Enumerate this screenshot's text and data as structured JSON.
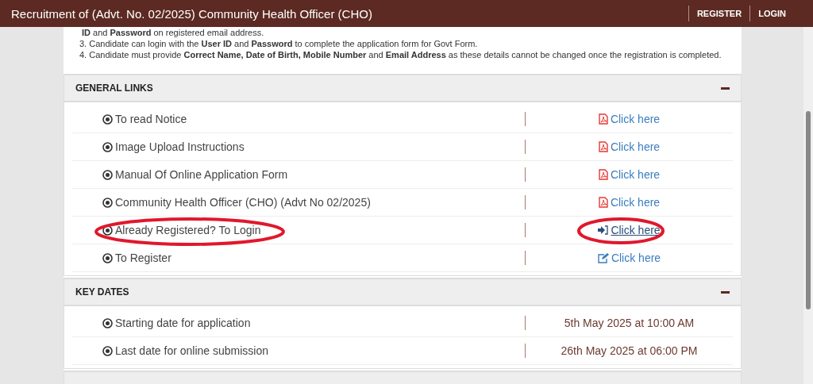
{
  "header": {
    "title": "Recruitment of (Advt. No. 02/2025) Community Health Officer (CHO)",
    "nav": [
      "REGISTER",
      "LOGIN"
    ]
  },
  "instructions": [
    "**ID** and **Password** on registered email address.",
    "3. Candidate can login with the **User ID** and **Password** to complete the application form for Govt Form.",
    "4. Candidate must provide **Correct Name, Date of Birth, Mobile Number** and **Email Address** as these details cannot be changed once the registration is completed."
  ],
  "panels": [
    {
      "title": "GENERAL LINKS",
      "expanded": true,
      "kind": "links",
      "rows": [
        {
          "label": "To read Notice",
          "link": "Click here",
          "kind": "pdf",
          "focused": false,
          "highlighted": false
        },
        {
          "label": "Image Upload Instructions",
          "link": "Click here",
          "kind": "pdf",
          "focused": false,
          "highlighted": false
        },
        {
          "label": "Manual Of Online Application Form",
          "link": "Click here",
          "kind": "pdf",
          "focused": false,
          "highlighted": false
        },
        {
          "label": "Community Health Officer (CHO) (Advt No 02/2025)",
          "link": "Click here",
          "kind": "pdf",
          "focused": false,
          "highlighted": false
        },
        {
          "label": "Already Registered? To Login",
          "link": "Click here",
          "kind": "login",
          "focused": true,
          "highlighted": true
        },
        {
          "label": "To Register",
          "link": "Click here",
          "kind": "edit",
          "focused": false,
          "highlighted": false
        }
      ]
    },
    {
      "title": "KEY DATES",
      "expanded": true,
      "kind": "dates",
      "rows": [
        {
          "label": "Starting date for application",
          "value": "5th May 2025 at 10:00 AM"
        },
        {
          "label": "Last date for online submission",
          "value": "26th May 2025 at 06:00 PM"
        }
      ]
    },
    {
      "kind": "stub"
    }
  ]
}
